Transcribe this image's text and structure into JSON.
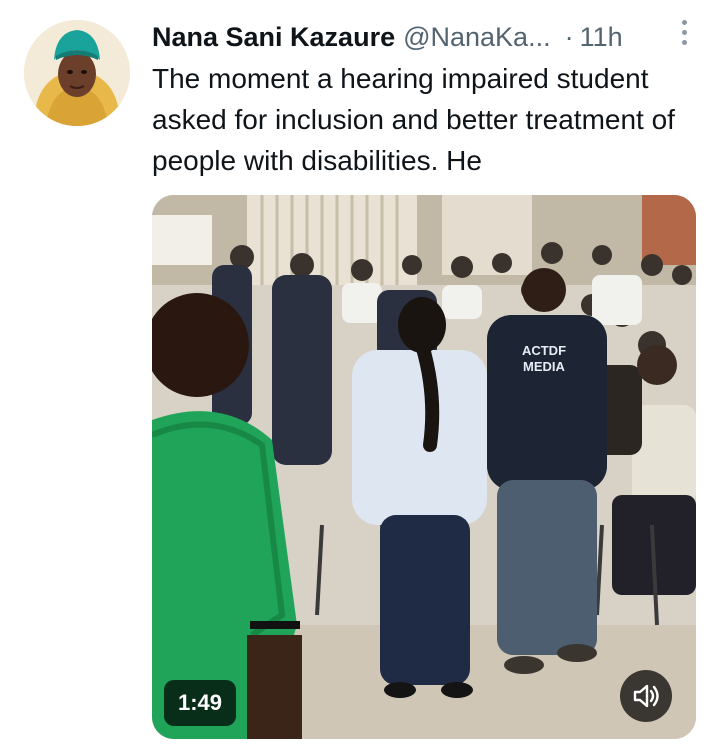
{
  "tweet": {
    "author_name": "Nana Sani Kazaure",
    "author_handle": "@NanaKa...",
    "separator": "·",
    "time": "11h",
    "text": "The moment a hearing impaired student asked for inclusion and better treatment of people with disabilities. He",
    "more_icon": "more-vertical-icon"
  },
  "media": {
    "type": "video",
    "duration": "1:49",
    "shirt_text": "ACTDF MEDIA",
    "volume_icon": "speaker-muted-icon"
  },
  "colors": {
    "name": "#0f1419",
    "secondary": "#536471",
    "overlay": "#000000"
  }
}
